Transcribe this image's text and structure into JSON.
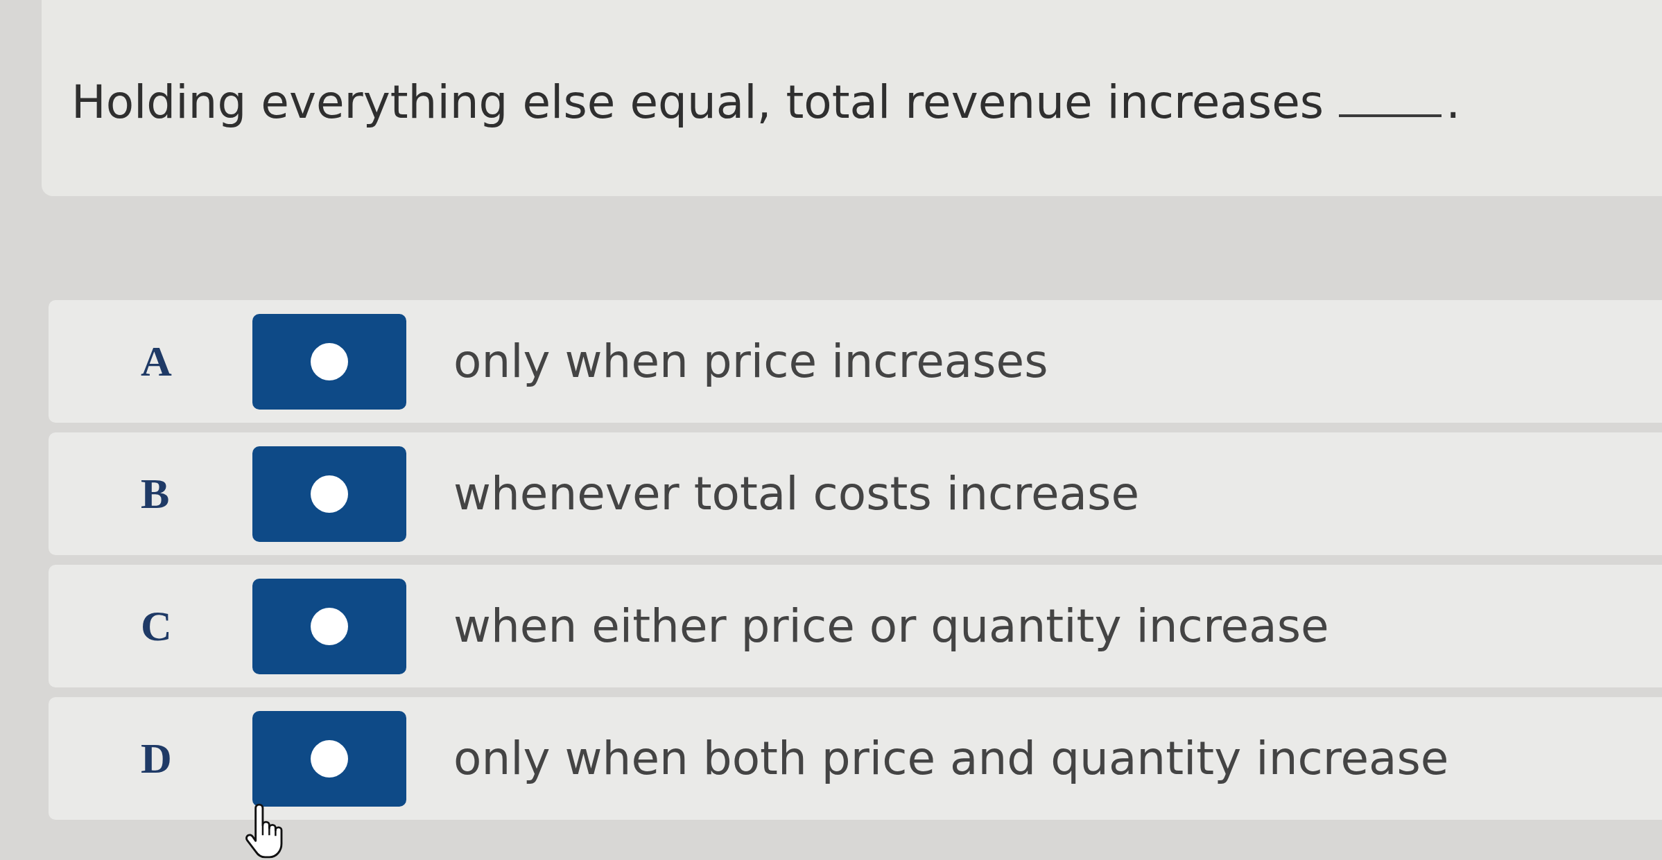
{
  "question": {
    "text": "Holding everything else equal, total revenue increases",
    "after_blank": "."
  },
  "options": [
    {
      "letter": "A",
      "text": "only when price increases",
      "selected": false
    },
    {
      "letter": "B",
      "text": "whenever total costs increase",
      "selected": false
    },
    {
      "letter": "C",
      "text": "when either price or quantity increase",
      "selected": false
    },
    {
      "letter": "D",
      "text": "only when both price and quantity increase",
      "selected": false
    }
  ]
}
